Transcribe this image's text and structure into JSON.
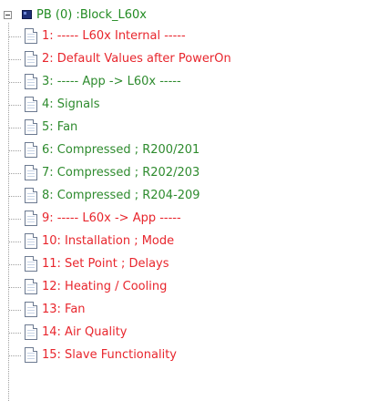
{
  "tree": {
    "root": {
      "label": "PB (0) :Block_L60x",
      "color": "#228b22"
    },
    "items": [
      {
        "label": "1: ----- L60x Internal -----",
        "color": "red"
      },
      {
        "label": "2: Default Values after PowerOn",
        "color": "red"
      },
      {
        "label": "3: ----- App -> L60x -----",
        "color": "green"
      },
      {
        "label": "4: Signals",
        "color": "green"
      },
      {
        "label": "5: Fan",
        "color": "green"
      },
      {
        "label": "6: Compressed ; R200/201",
        "color": "green"
      },
      {
        "label": "7: Compressed ; R202/203",
        "color": "green"
      },
      {
        "label": "8: Compressed ; R204-209",
        "color": "green"
      },
      {
        "label": "9: ----- L60x -> App -----",
        "color": "red"
      },
      {
        "label": "10: Installation ; Mode",
        "color": "red"
      },
      {
        "label": "11: Set Point ; Delays",
        "color": "red"
      },
      {
        "label": "12: Heating / Cooling",
        "color": "red"
      },
      {
        "label": "13: Fan",
        "color": "red"
      },
      {
        "label": "14: Air Quality",
        "color": "red"
      },
      {
        "label": "15: Slave Functionality",
        "color": "red"
      }
    ]
  }
}
